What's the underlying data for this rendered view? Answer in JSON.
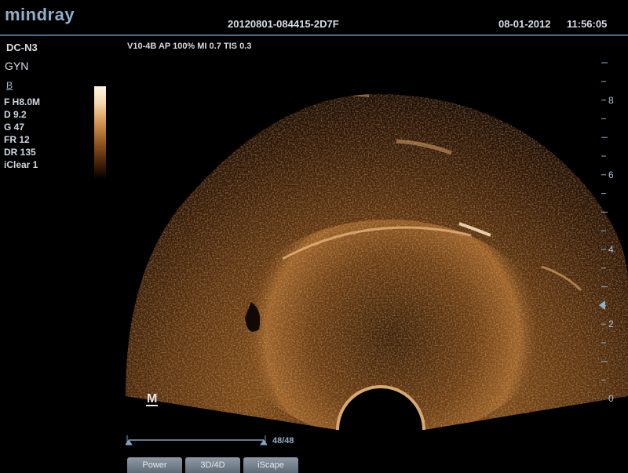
{
  "header": {
    "logo": "mindray",
    "exam_id": "20120801-084415-2D7F",
    "date": "08-01-2012",
    "time": "11:56:05"
  },
  "left_panel": {
    "probe": "DC-N3",
    "preset": "GYN",
    "mode": "B",
    "params": [
      "F H8.0M",
      "D 9.2",
      "G 47",
      "FR 12",
      "DR 135",
      "iClear 1"
    ]
  },
  "acquisition": {
    "text": "V10-4B  AP 100%  MI 0.7  TIS 0.3"
  },
  "depth_scale": {
    "labels": [
      "8",
      "6",
      "4",
      "2",
      "0"
    ]
  },
  "orientation_marker": "M",
  "cine": {
    "counter": "48/48"
  },
  "softkeys": [
    "Power",
    "3D/4D",
    "iScape"
  ],
  "colors": {
    "accent": "#4d6f8d",
    "image_tint": "#c98a48"
  }
}
